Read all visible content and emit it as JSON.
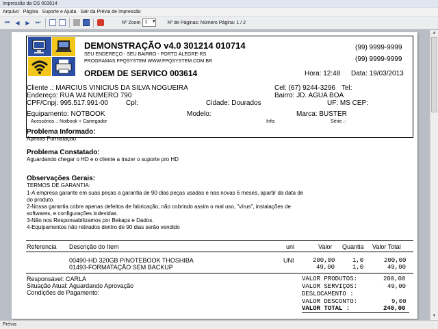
{
  "window": {
    "title": "Impressão da OS 003614"
  },
  "menu": [
    "Arquivo",
    "Página",
    "Suporte e Ajuda",
    "Sair da Prévia de Impressão"
  ],
  "toolbar": {
    "zoom_label": "Nº Zoom",
    "zoom_value": "1",
    "pages_label": "Nº de Páginas: Número Página: 1 / 2"
  },
  "status": "Prévia",
  "doc": {
    "title": "DEMONSTRAÇÃO v4.0 301214 010714",
    "address": "SEU ENDEREÇO - SEU BAIRRO - PORTO ALEGRE-RS",
    "site": "PROGRAMAS FPQSYSTEM  WWW.FPQSYSTEM.COM.BR",
    "phone1": "(99) 9999-9999",
    "phone2": "(99) 9999-9999",
    "order_title": "ORDEM DE SERVICO 003614",
    "hora": "Hora: 12:48",
    "data": "Data: 19/03/2013",
    "cliente": "Cliente   .: MARCIUS VINICIUS DA SILVA NOGUEIRA",
    "cel": "Cel: (67) 9244-3296",
    "tel": "Tel:",
    "endereco": "Endereço: RUA W4   NUMERO 790",
    "bairro": "Bairro: JD. AGUA BOA",
    "cpf": "CPF/Cnpj: 995.517.991-00",
    "cpl": "Cpl:",
    "cidade": "Cidade: Dourados",
    "uf": "UF: MS CEP:",
    "equipamento": "Equipamento: NOTBOOK",
    "modelo": "Modelo:",
    "marca": "Marca: BUSTER",
    "acessorios": "Acessórios .: Notbook + Carregador",
    "info": "Info:",
    "serie": "Série .:",
    "problema_informado_title": "Problema Informado:",
    "problema_informado": "Apenas Formataçao",
    "problema_constatado_title": "Problema Constatado:",
    "problema_constatado": "Aguardando chegar o HD     e o cliente a trazer o suporte pro HD",
    "obs_title": "Observações Gerais:",
    "obs_lines": [
      "TERMOS DE GARANTIA:",
      "1-A empresa garante em suas peças a garantia de 90 dias peças usadas e nas novas 6 meses, apartir da data de",
      "do produto.",
      "2-Nossa garantia cobre apenas defeitos de fabricação, não cobrindo assim o mal uso, \"vírus\",   instalações  de",
      "softwares, e configurações indevidas.",
      "3-Não nos Responsabilizamos por Bekaps e Dados.",
      "4-Equipamentos não retirados dentro de 90 dias serão vendido"
    ],
    "table_headers": {
      "referencia": "Referencia",
      "descricao": "Descrição do Item",
      "uni": "uni",
      "valor": "Valor",
      "quantia": "Quantia",
      "total": "Valor Total"
    },
    "items": [
      {
        "desc": "00490-HD 320GB P/NOTEBOOK THOSHIBA",
        "uni": "UNI",
        "valor": "200,00",
        "qtd": "1,0",
        "total": "200,00"
      },
      {
        "desc": "01493-FORMATAÇÃO SEM BACKUP",
        "uni": "",
        "valor": "49,00",
        "qtd": "1,0",
        "total": "49,00"
      }
    ],
    "responsavel": "Responsável: CARLA",
    "situacao": "Situação Atual: Aguardando Aprovação",
    "condicoes": "Condições de Pagamento:",
    "totals": [
      {
        "label": "VALOR PRODUTOS:",
        "value": "200,00",
        "bold": false
      },
      {
        "label": "VALOR SERVIÇOS:",
        "value": "49,00",
        "bold": false
      },
      {
        "label": "DESLOCAMENTO   :",
        "value": "",
        "bold": false
      },
      {
        "label": "VALOR DESCONTO:",
        "value": "9,00",
        "bold": false
      },
      {
        "label": "VALOR TOTAL    :",
        "value": "240,00",
        "bold": true
      }
    ]
  }
}
